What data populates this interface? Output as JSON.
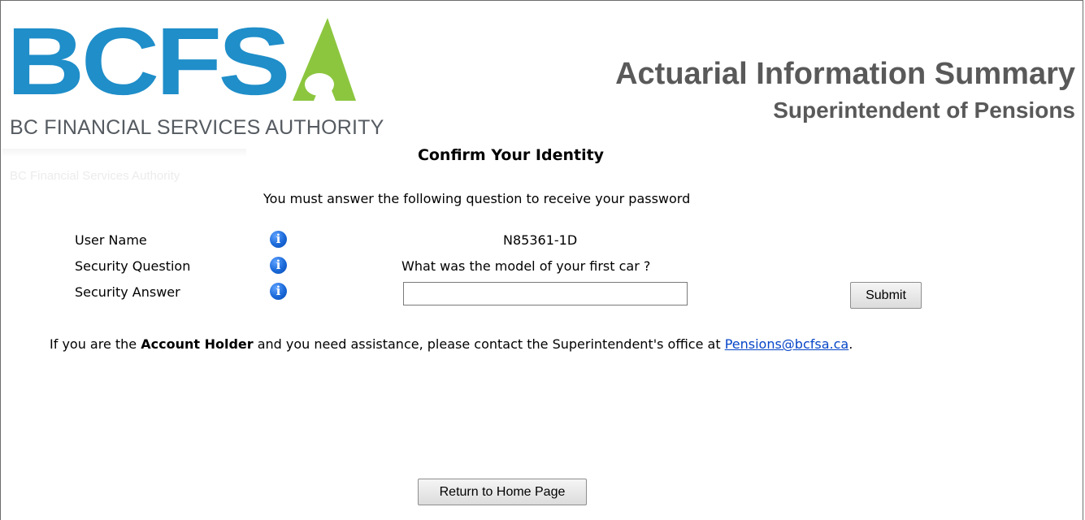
{
  "brand": {
    "logo_text": "BCFSA",
    "logo_colors": {
      "blue": "#1f8ec9",
      "green": "#8cc63f"
    },
    "subtitle": "BC FINANCIAL SERVICES AUTHORITY",
    "faint_text": "BC Financial Services Authority"
  },
  "header": {
    "title": "Actuarial Information Summary",
    "subtitle": "Superintendent of Pensions"
  },
  "form": {
    "heading": "Confirm Your Identity",
    "instruction": "You must answer the following question to receive your password",
    "rows": [
      {
        "label": "User Name",
        "value": "N85361-1D",
        "icon": "info-icon"
      },
      {
        "label": "Security Question",
        "value": "What was the model of your first car ?",
        "icon": "info-icon"
      },
      {
        "label": "Security Answer",
        "icon": "info-icon"
      }
    ],
    "answer_value": "",
    "submit_label": "Submit"
  },
  "help": {
    "prefix": "If you are the ",
    "bold": "Account Holder",
    "middle": " and you need assistance, please contact the Superintendent's office at ",
    "email": "Pensions@bcfsa.ca",
    "suffix": "."
  },
  "footer": {
    "home_label": "Return to Home Page"
  },
  "colors": {
    "link": "#0645c8",
    "info_icon": "#1a68d8",
    "header_text": "#595959"
  }
}
